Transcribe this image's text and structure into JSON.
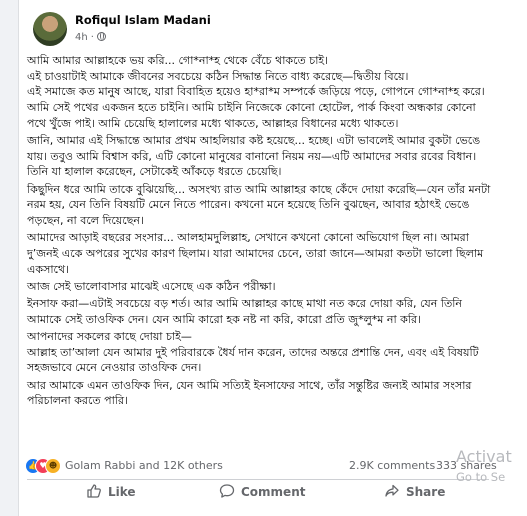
{
  "post": {
    "author": "Rofiqul Islam Madani",
    "time": "4h",
    "paragraphs": [
      "আমি আমার আল্লাহকে ভয় করি... গো*না*হ থেকে বেঁচে থাকতে চাই।\nএই চাওয়াটাই আমাকে জীবনের সবচেয়ে কঠিন সিদ্ধান্ত নিতে বাধ্য করেছে—দ্বিতীয় বিয়ে।\nএই সমাজে কত মানুষ আছে, যারা বিবাহিত হয়েও হা*রা*ম সম্পর্কে জড়িয়ে পড়ে, গোপনে গো*না*হ করে। আমি সেই পথের একজন হতে চাইনি। আমি চাইনি নিজেকে কোনো হোটেল, পার্ক কিংবা অন্ধকার কোনো পথে খুঁজে পাই। আমি চেয়েছি হালালের মধ্যে থাকতে, আল্লাহর বিধানের মধ্যে থাকতে।",
      "জানি, আমার এই সিদ্ধান্তে আমার প্রথম আহলিয়ার কষ্ট হয়েছে... হচ্ছে। এটা ভাবলেই আমার বুকটা ভেঙে যায়। তবুও আমি বিশ্বাস করি, এটি কোনো মানুষের বানানো নিয়ম নয়—এটি আমাদের সবার রবের বিধান। তিনি যা হালাল করেছেন, সেটাকেই আঁকড়ে ধরতে চেয়েছি।",
      "কিছুদিন ধরে আমি তাকে বুঝিয়েছি... অসংখ্য রাত আমি আল্লাহর কাছে কেঁদে দোয়া করেছি—যেন তাঁর মনটা নরম হয়, যেন তিনি বিষয়টি মেনে নিতে পারেন। কখনো মনে হয়েছে তিনি বুঝছেন, আবার হঠাৎই ভেঙে পড়ছেন, না বলে দিয়েছেন।",
      "আমাদের আড়াই বছরের সংসার... আলহামদুলিল্লাহ, সেখানে কখনো কোনো অভিযোগ ছিল না। আমরা দু’জনই একে অপরের সুখের কারণ ছিলাম। যারা আমাদের চেনে, তারা জানে—আমরা কতটা ভালো ছিলাম একসাথে।",
      "আজ সেই ভালোবাসার মাঝেই এসেছে এক কঠিন পরীক্ষা।",
      "ইনসাফ করা—এটাই সবচেয়ে বড় শর্ত। আর আমি আল্লাহর কাছে মাথা নত করে দোয়া করি, যেন তিনি আমাকে সেই তাওফিক দেন। যেন আমি কারো হক নষ্ট না করি, কারো প্রতি জু*লু*ম না করি।",
      "আপনাদের সকলের কাছে দোয়া চাই—\nআল্লাহ তা’আলা যেন আমার দুই পরিবারকে ধৈর্য দান করেন, তাদের অন্তরে প্রশান্তি দেন, এবং এই বিষয়টি সহজভাবে মেনে নেওয়ার তাওফিক দেন।",
      "আর আমাকে এমন তাওফিক দিন, যেন আমি সত্যিই ইনসাফের সাথে, তাঁর সন্তুষ্টির জন্যই আমার সংসার পরিচালনা করতে পারি।"
    ],
    "reactions_text": "Golam Rabbi and 12K others",
    "comments_count": "2.9K comments",
    "shares_count": "333 shares"
  },
  "actions": {
    "like": "Like",
    "comment": "Comment",
    "share": "Share"
  },
  "watermark": {
    "line1": "Activat",
    "line2": "Go to Se"
  },
  "colors": {
    "like_blue": "#1877f2",
    "love_red": "#f33e58",
    "haha_yellow": "#f7b125",
    "secondary_text": "#65676b"
  }
}
